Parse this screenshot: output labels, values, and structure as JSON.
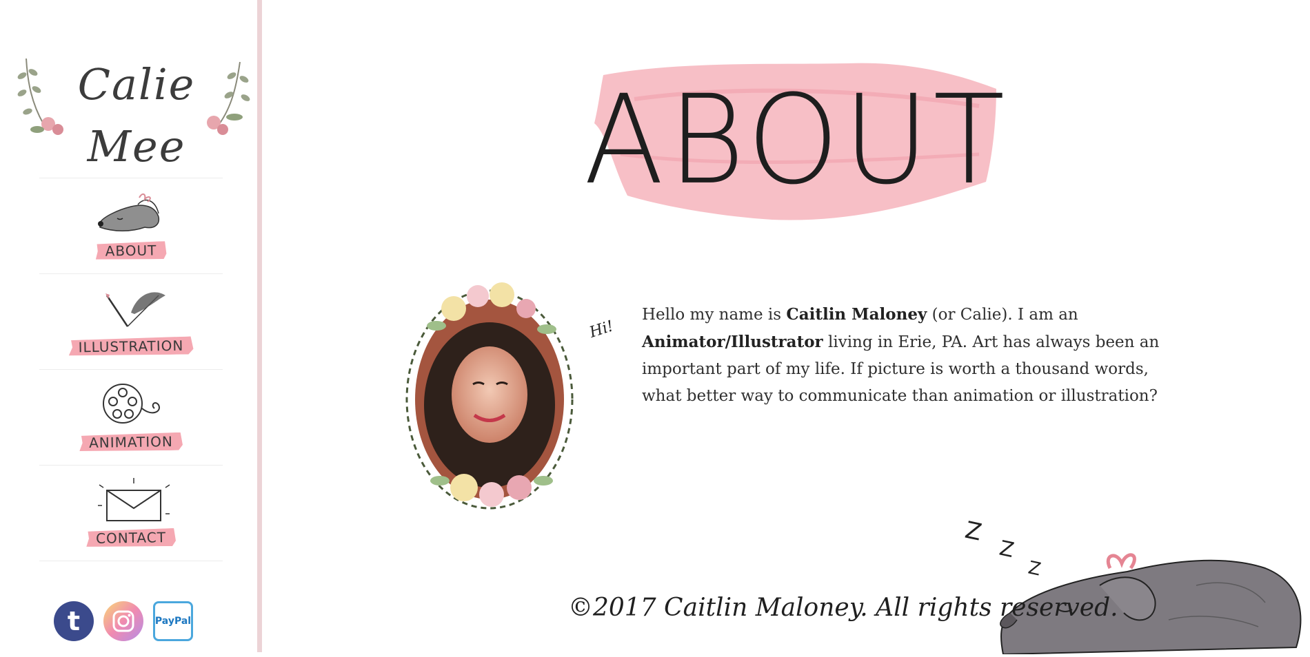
{
  "logo": {
    "text": "Calie Mee"
  },
  "nav": {
    "items": [
      {
        "label": "ABOUT",
        "icon": "dog-icon"
      },
      {
        "label": "ILLUSTRATION",
        "icon": "pencil-feather-icon"
      },
      {
        "label": "ANIMATION",
        "icon": "film-reel-icon"
      },
      {
        "label": "CONTACT",
        "icon": "envelope-icon"
      }
    ]
  },
  "social": {
    "tumblr": "t",
    "paypal": "PayPal"
  },
  "page": {
    "title": "ABOUT",
    "hi": "Hi!",
    "bio": {
      "part1": "Hello my name is ",
      "name": "Caitlin Maloney",
      "part2": " (or Calie). I am an ",
      "role": "Animator/Illustrator",
      "part3": " living in Erie, PA. Art has always been an important part of my life. If picture is worth a thousand words, what better way to communicate than animation or illustration?"
    },
    "zzz": "Z Z Z",
    "copyright": "©2017 Caitlin Maloney. All rights reserved."
  },
  "colors": {
    "accent_pink": "#f5a8b2",
    "sidebar_border": "#ecd3d6",
    "tumblr": "#3b4a8c",
    "paypal": "#1d78c1"
  }
}
